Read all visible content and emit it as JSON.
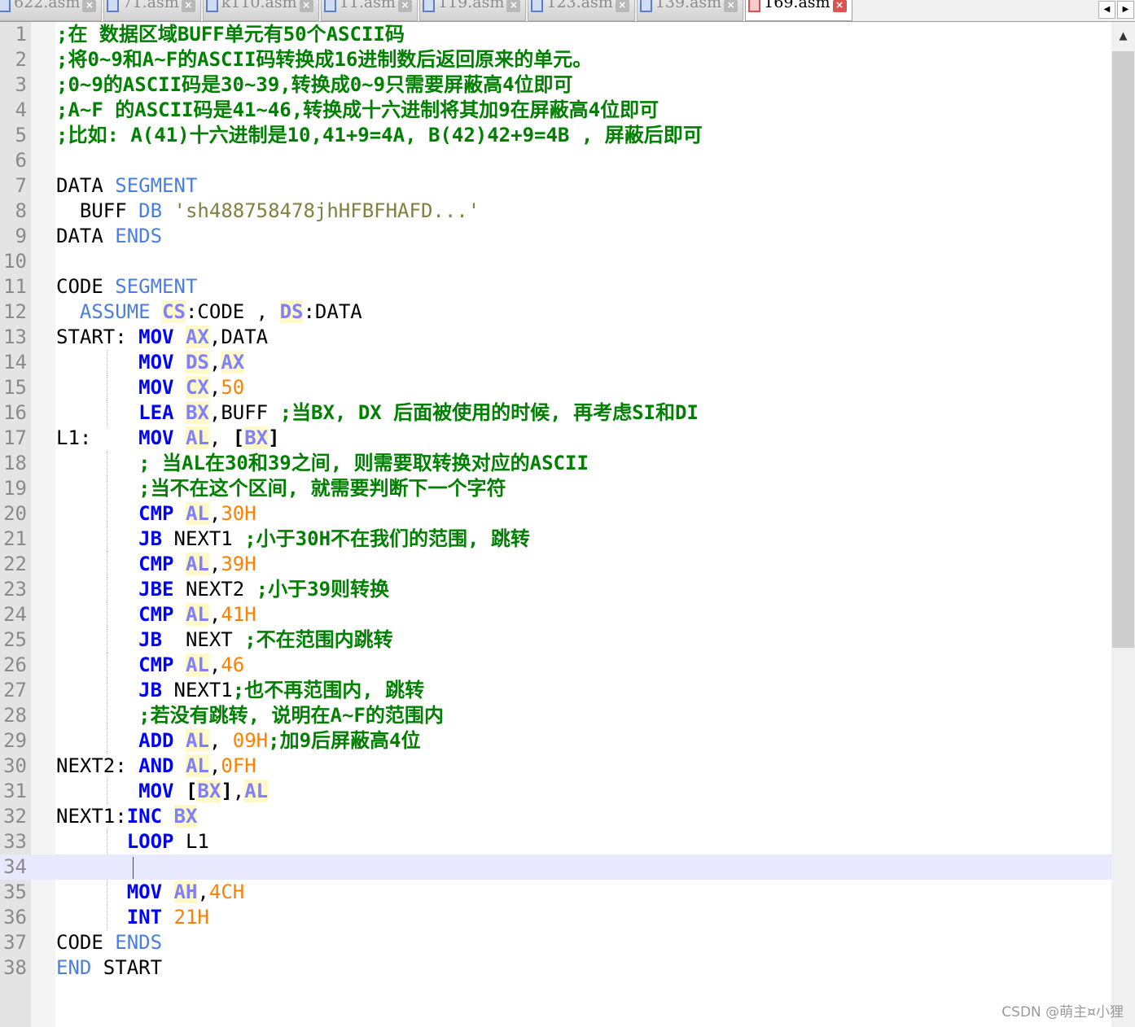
{
  "tabs": [
    {
      "name": "622.asm",
      "active": false
    },
    {
      "name": "71.asm",
      "active": false
    },
    {
      "name": "k110.asm",
      "active": false
    },
    {
      "name": "11.asm",
      "active": false
    },
    {
      "name": "119.asm",
      "active": false
    },
    {
      "name": "123.asm",
      "active": false
    },
    {
      "name": "139.asm",
      "active": false
    },
    {
      "name": "169.asm",
      "active": true
    }
  ],
  "tab_scroll": {
    "left": "◀",
    "right": "▶"
  },
  "scrollbar": {
    "up": "▲"
  },
  "editor": {
    "current_line": 34,
    "lines": [
      [
        {
          "t": ";在 数据区域BUFF单元有50个ASCII码",
          "c": "c"
        }
      ],
      [
        {
          "t": ";将0~9和A~F的ASCII码转换成16进制数后返回原来的单元。",
          "c": "c"
        }
      ],
      [
        {
          "t": ";0~9的ASCII码是30~39,转换成0~9只需要屏蔽高4位即可",
          "c": "c"
        }
      ],
      [
        {
          "t": ";A~F 的ASCII码是41~46,转换成十六进制将其加9在屏蔽高4位即可",
          "c": "c"
        }
      ],
      [
        {
          "t": ";比如: A(41)十六进制是10,41+9=4A, B(42)42+9=4B , 屏蔽后即可",
          "c": "c"
        }
      ],
      [],
      [
        {
          "t": "DATA "
        },
        {
          "t": "SEGMENT",
          "c": "d"
        }
      ],
      [
        {
          "t": "  BUFF "
        },
        {
          "t": "DB",
          "c": "d"
        },
        {
          "t": " "
        },
        {
          "t": "'sh488758478jhHFBFHAFD...'",
          "c": "s"
        }
      ],
      [
        {
          "t": "DATA "
        },
        {
          "t": "ENDS",
          "c": "d"
        }
      ],
      [],
      [
        {
          "t": "CODE "
        },
        {
          "t": "SEGMENT",
          "c": "d"
        }
      ],
      [
        {
          "t": "  "
        },
        {
          "t": "ASSUME",
          "c": "d"
        },
        {
          "t": " "
        },
        {
          "t": "CS",
          "c": "r"
        },
        {
          "t": ":CODE , "
        },
        {
          "t": "DS",
          "c": "r"
        },
        {
          "t": ":DATA"
        }
      ],
      [
        {
          "t": "START: "
        },
        {
          "t": "MOV",
          "c": "k"
        },
        {
          "t": " "
        },
        {
          "t": "AX",
          "c": "r"
        },
        {
          "t": ",DATA"
        }
      ],
      [
        {
          "t": "       "
        },
        {
          "t": "MOV",
          "c": "k"
        },
        {
          "t": " "
        },
        {
          "t": "DS",
          "c": "r"
        },
        {
          "t": ","
        },
        {
          "t": "AX",
          "c": "r"
        }
      ],
      [
        {
          "t": "       "
        },
        {
          "t": "MOV",
          "c": "k"
        },
        {
          "t": " "
        },
        {
          "t": "CX",
          "c": "r"
        },
        {
          "t": ","
        },
        {
          "t": "50",
          "c": "n"
        }
      ],
      [
        {
          "t": "       "
        },
        {
          "t": "LEA",
          "c": "k"
        },
        {
          "t": " "
        },
        {
          "t": "BX",
          "c": "r"
        },
        {
          "t": ",BUFF "
        },
        {
          "t": ";当BX, DX 后面被使用的时候, 再考虑SI和DI",
          "c": "c"
        }
      ],
      [
        {
          "t": "L1:    "
        },
        {
          "t": "MOV",
          "c": "k"
        },
        {
          "t": " "
        },
        {
          "t": "AL",
          "c": "r"
        },
        {
          "t": ", "
        },
        {
          "t": "[",
          "c": "b"
        },
        {
          "t": "BX",
          "c": "r"
        },
        {
          "t": "]",
          "c": "b"
        }
      ],
      [
        {
          "t": "       "
        },
        {
          "t": "; 当AL在30和39之间, 则需要取转换对应的ASCII",
          "c": "c"
        }
      ],
      [
        {
          "t": "       "
        },
        {
          "t": ";当不在这个区间, 就需要判断下一个字符",
          "c": "c"
        }
      ],
      [
        {
          "t": "       "
        },
        {
          "t": "CMP",
          "c": "k"
        },
        {
          "t": " "
        },
        {
          "t": "AL",
          "c": "r"
        },
        {
          "t": ","
        },
        {
          "t": "30H",
          "c": "n"
        }
      ],
      [
        {
          "t": "       "
        },
        {
          "t": "JB",
          "c": "k"
        },
        {
          "t": " NEXT1 "
        },
        {
          "t": ";小于30H不在我们的范围, 跳转",
          "c": "c"
        }
      ],
      [
        {
          "t": "       "
        },
        {
          "t": "CMP",
          "c": "k"
        },
        {
          "t": " "
        },
        {
          "t": "AL",
          "c": "r"
        },
        {
          "t": ","
        },
        {
          "t": "39H",
          "c": "n"
        }
      ],
      [
        {
          "t": "       "
        },
        {
          "t": "JBE",
          "c": "k"
        },
        {
          "t": " NEXT2 "
        },
        {
          "t": ";小于39则转换",
          "c": "c"
        }
      ],
      [
        {
          "t": "       "
        },
        {
          "t": "CMP",
          "c": "k"
        },
        {
          "t": " "
        },
        {
          "t": "AL",
          "c": "r"
        },
        {
          "t": ","
        },
        {
          "t": "41H",
          "c": "n"
        }
      ],
      [
        {
          "t": "       "
        },
        {
          "t": "JB",
          "c": "k"
        },
        {
          "t": "  NEXT "
        },
        {
          "t": ";不在范围内跳转",
          "c": "c"
        }
      ],
      [
        {
          "t": "       "
        },
        {
          "t": "CMP",
          "c": "k"
        },
        {
          "t": " "
        },
        {
          "t": "AL",
          "c": "r"
        },
        {
          "t": ","
        },
        {
          "t": "46",
          "c": "n"
        }
      ],
      [
        {
          "t": "       "
        },
        {
          "t": "JB",
          "c": "k"
        },
        {
          "t": " NEXT1"
        },
        {
          "t": ";也不再范围内, 跳转",
          "c": "c"
        }
      ],
      [
        {
          "t": "       "
        },
        {
          "t": ";若没有跳转, 说明在A~F的范围内",
          "c": "c"
        }
      ],
      [
        {
          "t": "       "
        },
        {
          "t": "ADD",
          "c": "k"
        },
        {
          "t": " "
        },
        {
          "t": "AL",
          "c": "r"
        },
        {
          "t": ", "
        },
        {
          "t": "09H",
          "c": "n"
        },
        {
          "t": ";加9后屏蔽高4位",
          "c": "c"
        }
      ],
      [
        {
          "t": "NEXT2: "
        },
        {
          "t": "AND",
          "c": "k"
        },
        {
          "t": " "
        },
        {
          "t": "AL",
          "c": "r"
        },
        {
          "t": ","
        },
        {
          "t": "0FH",
          "c": "n"
        }
      ],
      [
        {
          "t": "       "
        },
        {
          "t": "MOV",
          "c": "k"
        },
        {
          "t": " "
        },
        {
          "t": "[",
          "c": "b"
        },
        {
          "t": "BX",
          "c": "r"
        },
        {
          "t": "]",
          "c": "b"
        },
        {
          "t": ","
        },
        {
          "t": "AL",
          "c": "r"
        }
      ],
      [
        {
          "t": "NEXT1:"
        },
        {
          "t": "INC",
          "c": "k"
        },
        {
          "t": " "
        },
        {
          "t": "BX",
          "c": "r"
        }
      ],
      [
        {
          "t": "      "
        },
        {
          "t": "LOOP",
          "c": "k"
        },
        {
          "t": " L1"
        }
      ],
      [],
      [
        {
          "t": "      "
        },
        {
          "t": "MOV",
          "c": "k"
        },
        {
          "t": " "
        },
        {
          "t": "AH",
          "c": "r"
        },
        {
          "t": ","
        },
        {
          "t": "4CH",
          "c": "n"
        }
      ],
      [
        {
          "t": "      "
        },
        {
          "t": "INT",
          "c": "k"
        },
        {
          "t": " "
        },
        {
          "t": "21H",
          "c": "n"
        }
      ],
      [
        {
          "t": "CODE "
        },
        {
          "t": "ENDS",
          "c": "d"
        }
      ],
      [
        {
          "t": "END",
          "c": "d"
        },
        {
          "t": " START"
        }
      ]
    ]
  },
  "watermark": "CSDN @萌主¤小狸"
}
